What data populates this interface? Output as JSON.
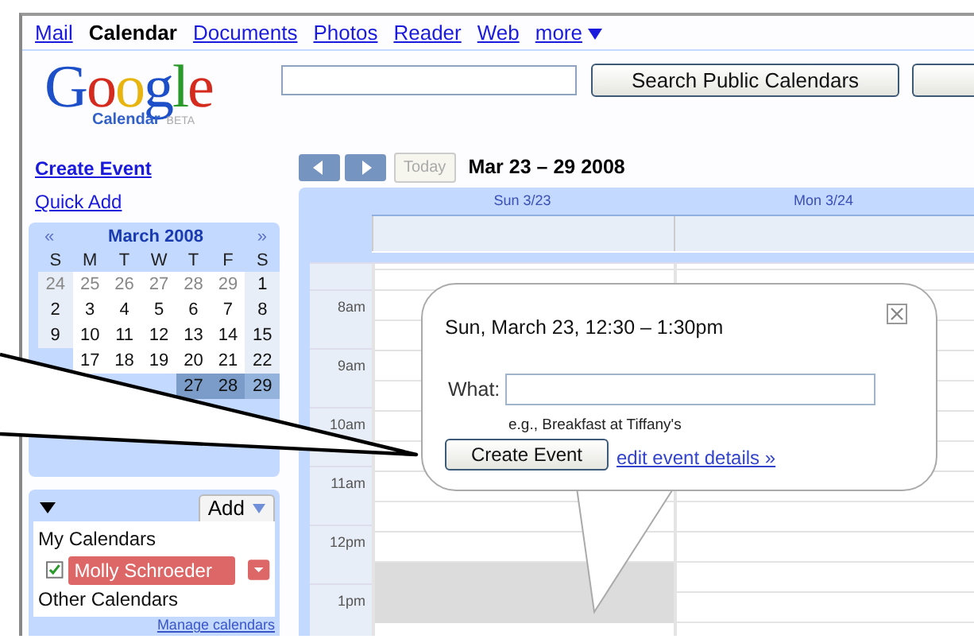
{
  "nav": {
    "links": [
      {
        "label": "Mail",
        "selected": false
      },
      {
        "label": "Calendar",
        "selected": true
      },
      {
        "label": "Documents",
        "selected": false
      },
      {
        "label": "Photos",
        "selected": false
      },
      {
        "label": "Reader",
        "selected": false
      },
      {
        "label": "Web",
        "selected": false
      },
      {
        "label": "more",
        "selected": false,
        "menu": true
      }
    ]
  },
  "logo": {
    "wordmark": "Google",
    "product": "Calendar",
    "badge": "BETA"
  },
  "search": {
    "button": "Search Public Calendars"
  },
  "sidebar": {
    "links": [
      "Create Event",
      "Quick Add"
    ],
    "mini_calendar": {
      "title": "March 2008",
      "prev": "«",
      "next": "»",
      "weekdays": [
        "S",
        "M",
        "T",
        "W",
        "T",
        "F",
        "S"
      ],
      "weeks": [
        {
          "selected": false,
          "days": [
            {
              "day": "24",
              "other_month": true
            },
            {
              "day": "25",
              "other_month": true
            },
            {
              "day": "26",
              "other_month": true
            },
            {
              "day": "27",
              "other_month": true
            },
            {
              "day": "28",
              "other_month": true
            },
            {
              "day": "29",
              "other_month": true
            },
            {
              "day": "1",
              "other_month": false
            }
          ]
        },
        {
          "selected": false,
          "days": [
            {
              "day": "2",
              "other_month": false
            },
            {
              "day": "3",
              "other_month": false
            },
            {
              "day": "4",
              "other_month": false
            },
            {
              "day": "5",
              "other_month": false
            },
            {
              "day": "6",
              "other_month": false
            },
            {
              "day": "7",
              "other_month": false
            },
            {
              "day": "8",
              "other_month": false
            }
          ]
        },
        {
          "selected": false,
          "days": [
            {
              "day": "9",
              "other_month": false
            },
            {
              "day": "10",
              "other_month": false
            },
            {
              "day": "11",
              "other_month": false
            },
            {
              "day": "12",
              "other_month": false
            },
            {
              "day": "13",
              "other_month": false
            },
            {
              "day": "14",
              "other_month": false
            },
            {
              "day": "15",
              "other_month": false
            }
          ]
        },
        {
          "selected": false,
          "days": [
            {
              "day": "17",
              "other_month": false
            },
            {
              "day": "18",
              "other_month": false
            },
            {
              "day": "19",
              "other_month": false
            },
            {
              "day": "20",
              "other_month": false
            },
            {
              "day": "21",
              "other_month": false
            },
            {
              "day": "22",
              "other_month": false
            }
          ]
        },
        {
          "selected": true,
          "days": [
            {
              "day": "27",
              "other_month": false
            },
            {
              "day": "28",
              "other_month": false
            },
            {
              "day": "29",
              "other_month": false
            }
          ]
        }
      ]
    },
    "calendars": {
      "add_button": "Add",
      "sections": [
        {
          "title": "My Calendars",
          "items": [
            {
              "name": "Molly Schroeder",
              "checked": true,
              "color": "#dd6666"
            }
          ]
        },
        {
          "title": "Other Calendars"
        }
      ],
      "manage_link": "Manage calendars"
    }
  },
  "toolbar": {
    "today": {
      "label": "Today",
      "disabled": true
    },
    "range": "Mar 23 – 29 2008"
  },
  "week": {
    "days": [
      "Sun 3/23",
      "Mon 3/24"
    ],
    "hours": [
      {
        "label": "8am",
        "first_half_selected": false,
        "second_half_selected": false
      },
      {
        "label": "9am",
        "first_half_selected": false,
        "second_half_selected": false
      },
      {
        "label": "10am",
        "first_half_selected": false,
        "second_half_selected": false
      },
      {
        "label": "11am",
        "first_half_selected": false,
        "second_half_selected": false
      },
      {
        "label": "12pm",
        "first_half_selected": false,
        "second_half_selected": true
      },
      {
        "label": "1pm",
        "first_half_selected": true,
        "second_half_selected": false
      }
    ]
  },
  "popup": {
    "title": "Sun, March 23, 12:30 – 1:30pm",
    "field_label": "What:",
    "hint": "e.g., Breakfast at Tiffany's",
    "button": "Create Event",
    "link": "edit event details »"
  }
}
